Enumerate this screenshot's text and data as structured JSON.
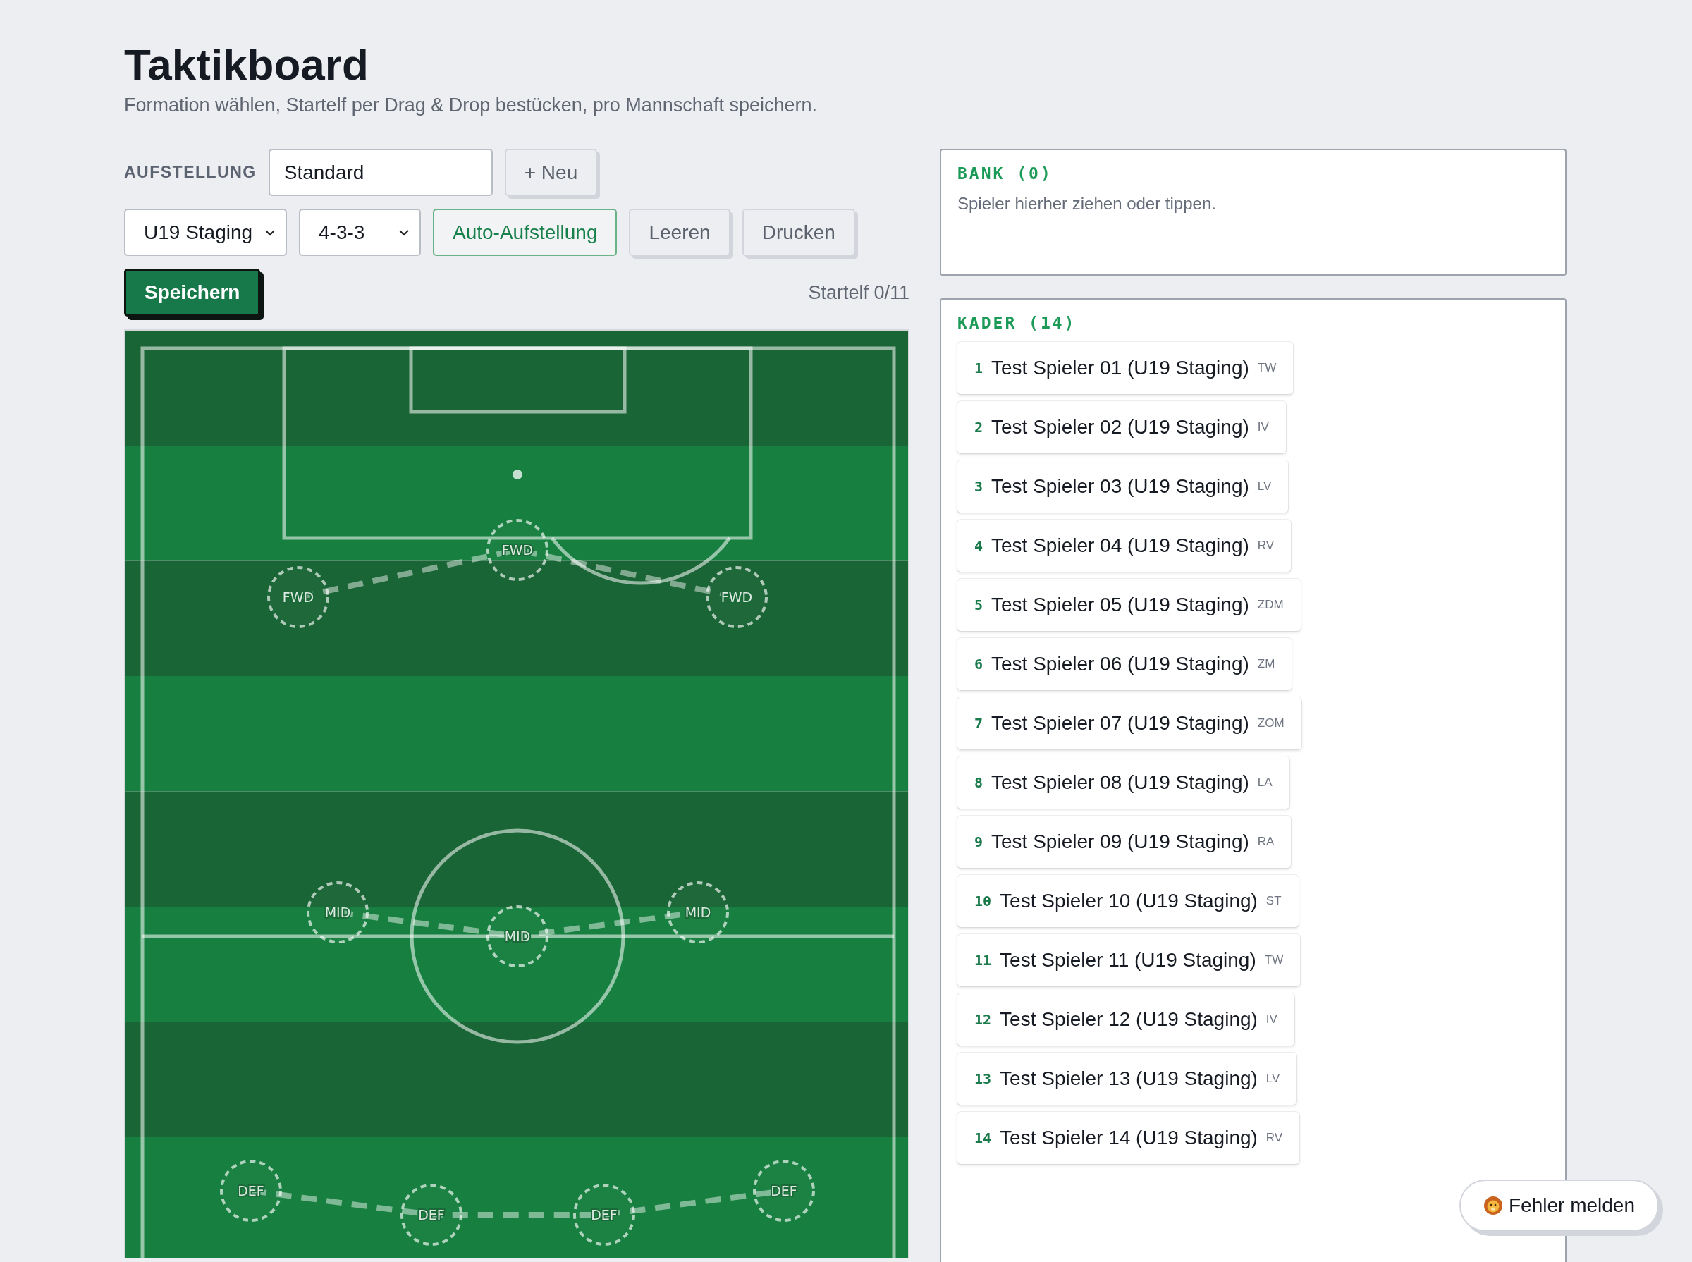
{
  "header": {
    "title": "Taktikboard",
    "subtitle": "Formation wählen, Startelf per Drag & Drop bestücken, pro Mannschaft speichern."
  },
  "lineup": {
    "label": "AUFSTELLUNG",
    "name_value": "Standard",
    "new_button": "+ Neu"
  },
  "controls": {
    "team_select": "U19 Staging",
    "formation_select": "4-3-3",
    "buttons": [
      {
        "label": "Auto-Aufstellung",
        "kind": "outline"
      },
      {
        "label": "Leeren",
        "kind": "plain"
      },
      {
        "label": "Drucken",
        "kind": "plain"
      }
    ]
  },
  "save_button": "Speichern",
  "startelf_count": "Startelf 0/11",
  "pitch": {
    "slots": [
      {
        "label": "FWD"
      },
      {
        "label": "FWD"
      },
      {
        "label": "FWD"
      },
      {
        "label": "MID"
      },
      {
        "label": "MID"
      },
      {
        "label": "MID"
      },
      {
        "label": "DEF"
      },
      {
        "label": "DEF"
      },
      {
        "label": "DEF"
      },
      {
        "label": "DEF"
      }
    ]
  },
  "bank": {
    "title": "BANK (0)",
    "hint": "Spieler hierher ziehen oder tippen."
  },
  "squad": {
    "title": "KADER (14)",
    "players": [
      {
        "number": "1",
        "name": "Test Spieler 01 (U19 Staging)",
        "position": "TW"
      },
      {
        "number": "2",
        "name": "Test Spieler 02 (U19 Staging)",
        "position": "IV"
      },
      {
        "number": "3",
        "name": "Test Spieler 03 (U19 Staging)",
        "position": "LV"
      },
      {
        "number": "4",
        "name": "Test Spieler 04 (U19 Staging)",
        "position": "RV"
      },
      {
        "number": "5",
        "name": "Test Spieler 05 (U19 Staging)",
        "position": "ZDM"
      },
      {
        "number": "6",
        "name": "Test Spieler 06 (U19 Staging)",
        "position": "ZM"
      },
      {
        "number": "7",
        "name": "Test Spieler 07 (U19 Staging)",
        "position": "ZOM"
      },
      {
        "number": "8",
        "name": "Test Spieler 08 (U19 Staging)",
        "position": "LA"
      },
      {
        "number": "9",
        "name": "Test Spieler 09 (U19 Staging)",
        "position": "RA"
      },
      {
        "number": "10",
        "name": "Test Spieler 10 (U19 Staging)",
        "position": "ST"
      },
      {
        "number": "11",
        "name": "Test Spieler 11 (U19 Staging)",
        "position": "TW"
      },
      {
        "number": "12",
        "name": "Test Spieler 12 (U19 Staging)",
        "position": "IV"
      },
      {
        "number": "13",
        "name": "Test Spieler 13 (U19 Staging)",
        "position": "LV"
      },
      {
        "number": "14",
        "name": "Test Spieler 14 (U19 Staging)",
        "position": "RV"
      }
    ]
  },
  "feedback_button": "Fehler melden"
}
